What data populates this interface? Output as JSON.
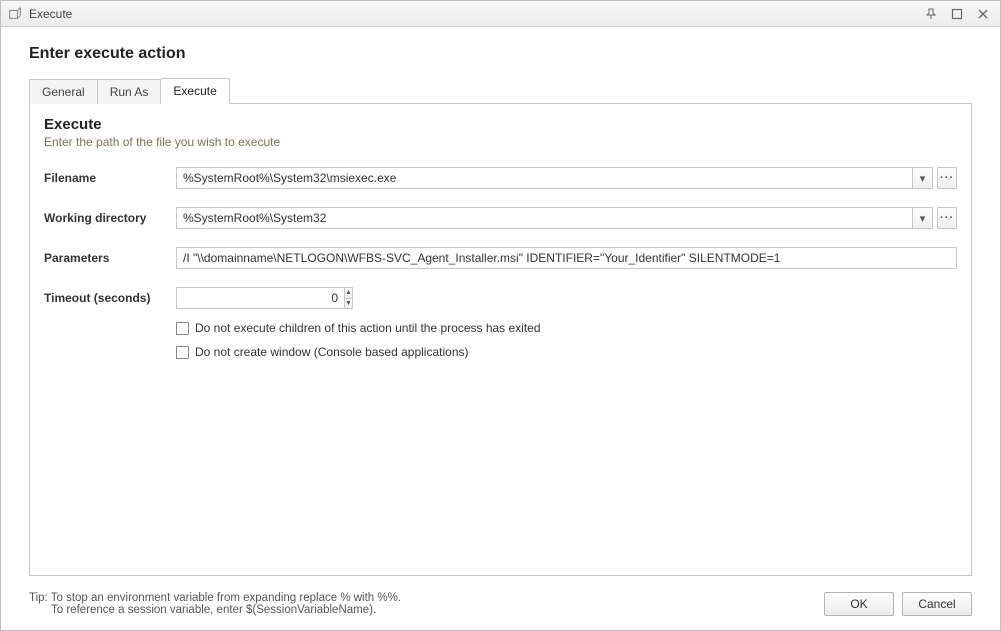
{
  "window_title": "Execute",
  "page_title": "Enter execute action",
  "tabs": [
    {
      "label": "General"
    },
    {
      "label": "Run As"
    },
    {
      "label": "Execute"
    }
  ],
  "section": {
    "title": "Execute",
    "desc": "Enter the path of the file you wish to execute"
  },
  "fields": {
    "filename": {
      "label": "Filename",
      "value": "%SystemRoot%\\System32\\msiexec.exe"
    },
    "workdir": {
      "label": "Working directory",
      "value": "%SystemRoot%\\System32"
    },
    "parameters": {
      "label": "Parameters",
      "value": "/I \"\\\\domainname\\NETLOGON\\WFBS-SVC_Agent_Installer.msi\" IDENTIFIER=\"Your_Identifier\" SILENTMODE=1"
    },
    "timeout": {
      "label": "Timeout (seconds)",
      "value": "0"
    }
  },
  "checkboxes": {
    "wait_children": "Do not execute children of this action until the process has exited",
    "no_window": "Do not create window (Console based applications)"
  },
  "tip": {
    "line1": "Tip: To stop an environment variable from expanding replace % with %%.",
    "line2": "To reference a session variable, enter $(SessionVariableName)."
  },
  "buttons": {
    "ok": "OK",
    "cancel": "Cancel"
  },
  "browse_glyph": "···",
  "caret_glyph": "▾",
  "spin_up": "▲",
  "spin_down": "▼"
}
